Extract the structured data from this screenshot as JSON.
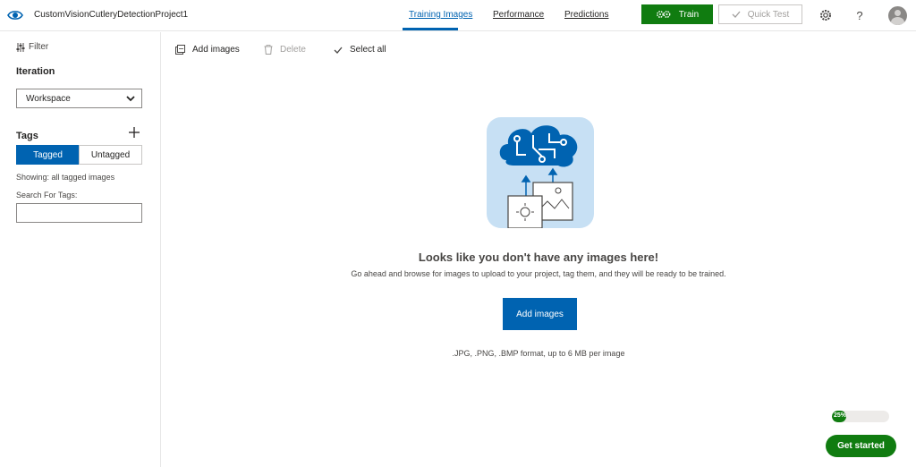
{
  "header": {
    "project_title": "CustomVisionCutleryDetectionProject1",
    "tabs": [
      {
        "label": "Training Images",
        "active": true
      },
      {
        "label": "Performance",
        "active": false
      },
      {
        "label": "Predictions",
        "active": false
      }
    ],
    "train_label": "Train",
    "quick_test_label": "Quick Test",
    "settings_icon": "gear-icon",
    "help_label": "?"
  },
  "sidebar": {
    "filter_label": "Filter",
    "iteration_heading": "Iteration",
    "iteration_selected": "Workspace",
    "tags_heading": "Tags",
    "tag_toggle": {
      "tagged_label": "Tagged",
      "untagged_label": "Untagged",
      "selected": "Tagged"
    },
    "showing_text": "Showing: all tagged images",
    "search_label": "Search For Tags:",
    "search_value": ""
  },
  "toolbar": {
    "add_images_label": "Add images",
    "delete_label": "Delete",
    "select_all_label": "Select all"
  },
  "empty_state": {
    "title": "Looks like you don't have any images here!",
    "description": "Go ahead and browse for images to upload to your project, tag them, and they will be ready to be trained.",
    "button_label": "Add images",
    "formats_text": ".JPG, .PNG, .BMP format, up to 6 MB per image"
  },
  "onboarding": {
    "progress_percent": 25,
    "progress_label": "25%",
    "get_started_label": "Get started"
  },
  "colors": {
    "accent_blue": "#0063b1",
    "train_green": "#107c10",
    "illustration_bg": "#c7e0f4"
  }
}
